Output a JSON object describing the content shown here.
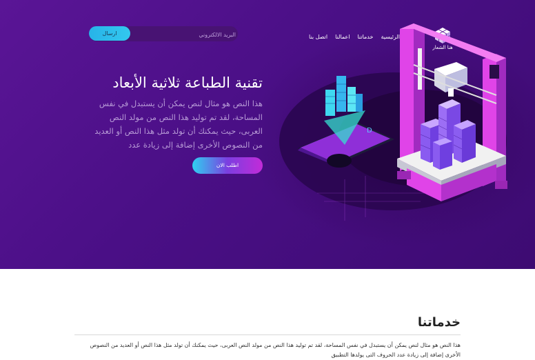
{
  "header": {
    "email_placeholder": "البريد الالكتروني",
    "send_label": "ارسال",
    "nav": [
      "الرئيسية",
      "خدماتنا",
      "اعمالنا",
      "اتصل بنا"
    ],
    "logo_text": "هنا الشعار"
  },
  "hero": {
    "title": "تقنية الطباعة ثلاثية الأبعاد",
    "text": "هذا النص هو مثال لنص يمكن أن يستبدل في نفس المساحة، لقد تم توليد هذا النص من مولد النص العربى، حيث يمكنك أن تولد مثل هذا النص أو العديد من النصوص الأخرى إضافة إلى زيادة عدد",
    "cta_label": "اطلب الان",
    "colors": {
      "accent_cyan": "#2fd0f0",
      "accent_magenta": "#c22bd8",
      "background": "#4a0f86"
    }
  },
  "services": {
    "title": "خدماتنا",
    "text": "هذا النص هو مثال لنص يمكن أن يستبدل في نفس المساحة، لقد تم توليد هذا النص من مولد النص العربى، حيث يمكنك أن تولد مثل هذا النص أو العديد من النصوص الأخرى إضافة إلى زيادة عدد الحروف التى يولدها التطبيق"
  }
}
